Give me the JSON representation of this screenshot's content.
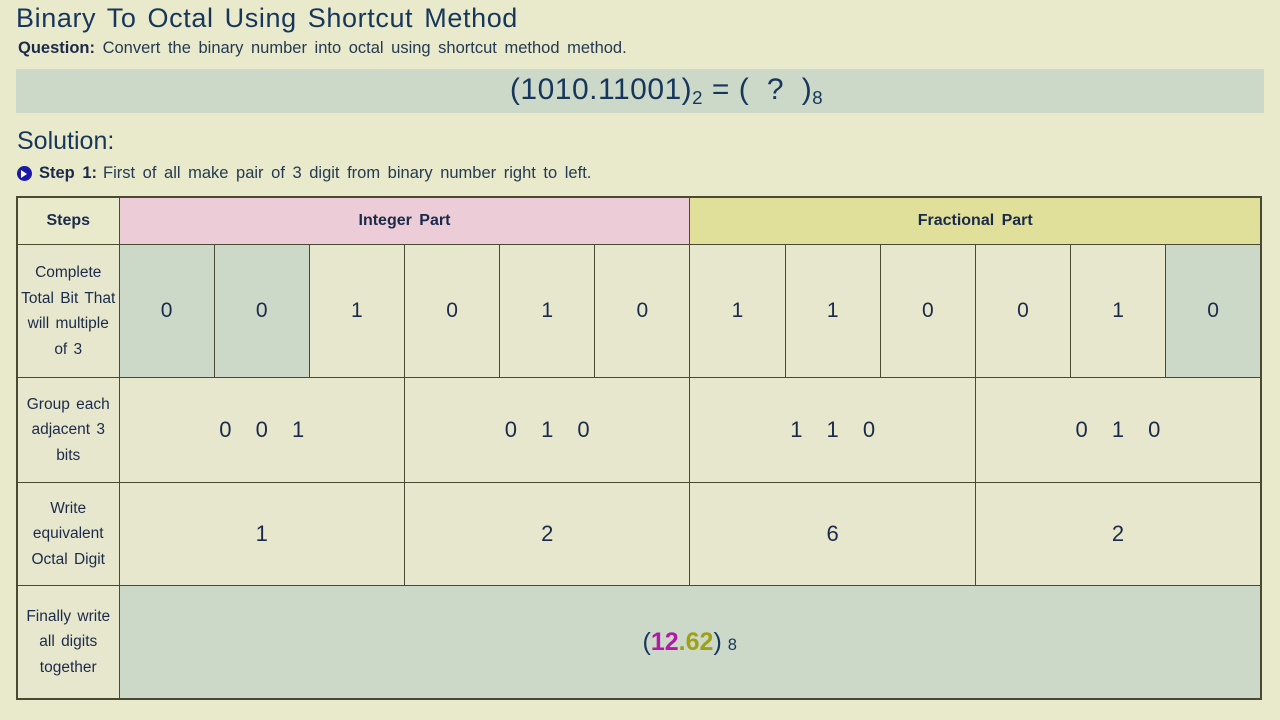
{
  "title": "Binary To Octal Using Shortcut Method",
  "question": {
    "label": "Question:",
    "text": "Convert the binary number into octal using shortcut method method."
  },
  "equation": {
    "lhs_value": "(1010.11001)",
    "lhs_base": "2",
    "equals": " = ",
    "rhs_value": "(  ?  )",
    "rhs_base": "8"
  },
  "solution_heading": "Solution:",
  "step": {
    "label": "Step 1:",
    "text": "First of all make pair of 3 digit from binary number right to left."
  },
  "table": {
    "headers": {
      "steps": "Steps",
      "integer_part": "Integer Part",
      "fractional_part": "Fractional Part"
    },
    "rows": [
      {
        "label": "Complete Total Bit That will multiple of 3",
        "integer_bits": [
          "0",
          "0",
          "1",
          "0",
          "1",
          "0"
        ],
        "integer_padded": [
          true,
          true,
          false,
          false,
          false,
          false
        ],
        "fractional_bits": [
          "1",
          "1",
          "0",
          "0",
          "1",
          "0"
        ],
        "fractional_padded": [
          false,
          false,
          false,
          false,
          false,
          true
        ]
      },
      {
        "label": "Group each adjacent 3 bits",
        "integer_groups": [
          "0 0 1",
          "0 1 0"
        ],
        "fractional_groups": [
          "1 1 0",
          "0 1 0"
        ]
      },
      {
        "label": "Write equivalent Octal Digit",
        "integer_digits": [
          "1",
          "2"
        ],
        "fractional_digits": [
          "6",
          "2"
        ]
      },
      {
        "label": "Finally write all digits together",
        "answer_open_paren": "(",
        "answer_integer": "12",
        "answer_dot": ".",
        "answer_fraction": "62",
        "answer_close_paren": ")",
        "answer_base": "8"
      }
    ]
  },
  "colors": {
    "page_background": "#e9e9cb",
    "cell_background": "#e7e7cd",
    "highlight_green": "#ccd8c8",
    "header_integer_pink": "#eccdd7",
    "header_fraction_olive": "#e0e09a",
    "text_navy": "#16365c",
    "border": "#4a4a32",
    "answer_integer": "#b01aa6",
    "answer_fraction": "#a0a017",
    "bullet_blue": "#1a1aaa"
  }
}
